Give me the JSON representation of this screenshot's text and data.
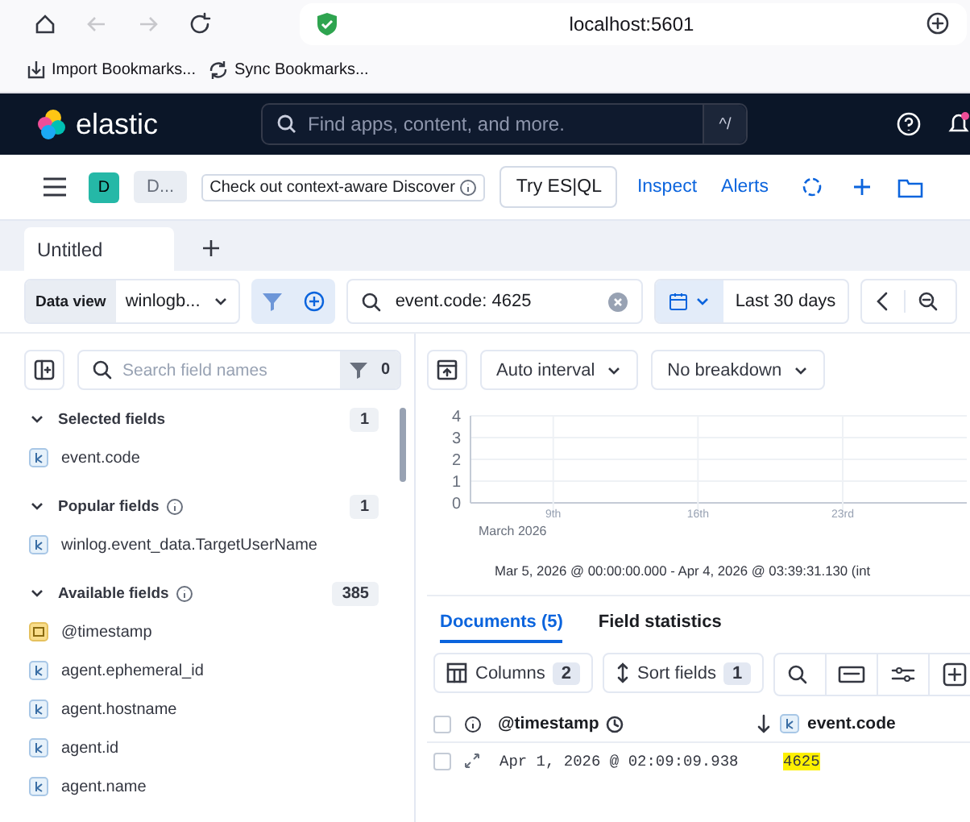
{
  "browser": {
    "address": "localhost:5601",
    "bookmarks": [
      "Import Bookmarks...",
      "Sync Bookmarks..."
    ]
  },
  "header": {
    "logo": "elastic",
    "search_placeholder": "Find apps, content, and more.",
    "shortcut": "^/"
  },
  "toolbar": {
    "space_initial": "D",
    "breadcrumb": "D...",
    "promo": "Check out context-aware Discover",
    "try_button": "Try ES|QL",
    "links": [
      "Inspect",
      "Alerts"
    ]
  },
  "tabs": [
    {
      "label": "Untitled",
      "selected": true
    }
  ],
  "query": {
    "data_view_label": "Data view",
    "data_view": "winlogb...",
    "query": "event.code: 4625",
    "time": "Last 30 days"
  },
  "sidebar": {
    "search_placeholder": "Search field names",
    "filter_count": "0",
    "sections": [
      {
        "title": "Selected fields",
        "count": "1",
        "info": false,
        "expanded": true,
        "fields": [
          {
            "name": "event.code",
            "kind": "keyword"
          }
        ]
      },
      {
        "title": "Popular fields",
        "count": "1",
        "info": true,
        "expanded": true,
        "fields": [
          {
            "name": "winlog.event_data.TargetUserName",
            "kind": "keyword"
          }
        ]
      },
      {
        "title": "Available fields",
        "count": "385",
        "info": true,
        "expanded": true,
        "fields": [
          {
            "name": "@timestamp",
            "kind": "date"
          },
          {
            "name": "agent.ephemeral_id",
            "kind": "keyword"
          },
          {
            "name": "agent.hostname",
            "kind": "keyword"
          },
          {
            "name": "agent.id",
            "kind": "keyword"
          },
          {
            "name": "agent.name",
            "kind": "keyword"
          }
        ]
      }
    ]
  },
  "histogram": {
    "interval": "Auto interval",
    "breakdown": "No breakdown",
    "chart_data": {
      "type": "bar",
      "xlabel": "March 2026",
      "xlim": [
        5,
        29
      ],
      "ylim": [
        0,
        4
      ],
      "grid": true,
      "yticks": [
        {
          "value": 0,
          "label": "0"
        },
        {
          "value": 1,
          "label": "1"
        },
        {
          "value": 2,
          "label": "2"
        },
        {
          "value": 3,
          "label": "3"
        },
        {
          "value": 4,
          "label": "4"
        }
      ],
      "xticks": [
        {
          "value": 9,
          "label": "9th"
        },
        {
          "value": 16,
          "label": "16th"
        },
        {
          "value": 23,
          "label": "23rd"
        }
      ]
    },
    "range": "Mar 5, 2026 @ 00:00:00.000 - Apr 4, 2026 @ 03:39:31.130 (int"
  },
  "doc_tabs": [
    {
      "label": "Documents (5)",
      "selected": true
    },
    {
      "label": "Field statistics",
      "selected": false
    }
  ],
  "grid_toolbar": {
    "columns": "Columns",
    "columns_count": "2",
    "sort": "Sort fields",
    "sort_count": "1"
  },
  "table": {
    "all_checked": false,
    "columns": [
      {
        "label": "@timestamp",
        "kind": "date"
      },
      {
        "label": "event.code",
        "kind": "keyword"
      }
    ],
    "rows": [
      {
        "checked": false,
        "cells": [
          "Apr 1, 2026 @ 02:09:09.938",
          "4625"
        ],
        "highlighted": true
      }
    ]
  }
}
